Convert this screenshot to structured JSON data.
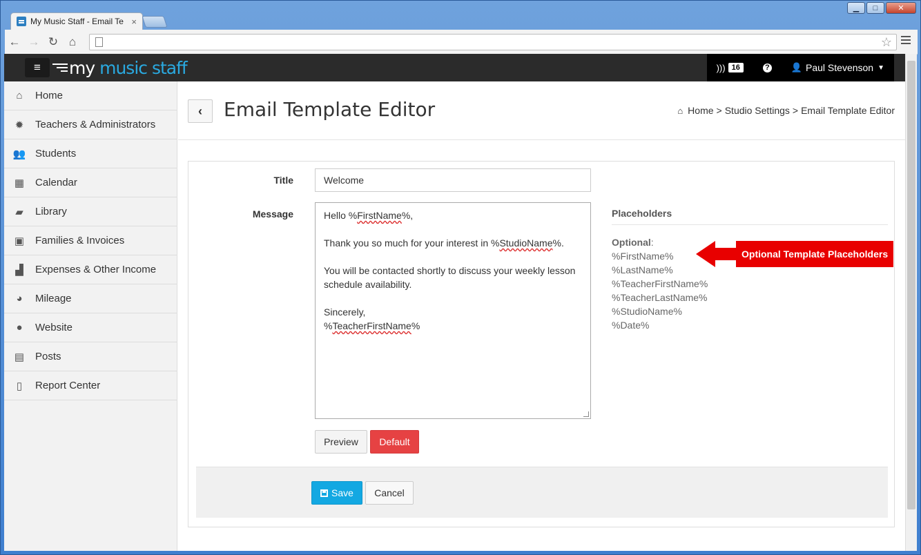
{
  "browser": {
    "tab_title": "My Music Staff - Email Te",
    "tab_close": "×",
    "url": ""
  },
  "header": {
    "logo_my": "my",
    "logo_rest": "music staff",
    "notifications_count": "16",
    "user_name": "Paul Stevenson"
  },
  "sidebar": {
    "items": [
      {
        "label": "Home",
        "icon": "home-icon"
      },
      {
        "label": "Teachers & Administrators",
        "icon": "gear-badge-icon"
      },
      {
        "label": "Students",
        "icon": "users-icon"
      },
      {
        "label": "Calendar",
        "icon": "calendar-icon"
      },
      {
        "label": "Library",
        "icon": "book-icon"
      },
      {
        "label": "Families & Invoices",
        "icon": "money-icon"
      },
      {
        "label": "Expenses & Other Income",
        "icon": "bar-chart-icon"
      },
      {
        "label": "Mileage",
        "icon": "dashboard-icon"
      },
      {
        "label": "Website",
        "icon": "globe-icon"
      },
      {
        "label": "Posts",
        "icon": "newspaper-icon"
      },
      {
        "label": "Report Center",
        "icon": "file-icon"
      }
    ]
  },
  "page": {
    "title": "Email Template Editor",
    "breadcrumb": [
      "Home",
      "Studio Settings",
      "Email Template Editor"
    ],
    "breadcrumb_sep": ">"
  },
  "form": {
    "title_label": "Title",
    "title_value": "Welcome",
    "message_label": "Message",
    "message_lines": {
      "greet_pre": "Hello %",
      "greet_var": "FirstName",
      "greet_post": "%,",
      "thanks_pre": "Thank you so much for your interest in %",
      "thanks_var": "StudioName",
      "thanks_post": "%.",
      "contact": "You will be contacted shortly to discuss your weekly lesson schedule availability.",
      "sincerely": "Sincerely,",
      "sign_pre": "%",
      "sign_var": "TeacherFirstName",
      "sign_post": "%"
    },
    "preview_label": "Preview",
    "default_label": "Default",
    "save_label": "Save",
    "cancel_label": "Cancel"
  },
  "placeholders": {
    "heading": "Placeholders",
    "optional_label": "Optional",
    "items": [
      "%FirstName%",
      "%LastName%",
      "%TeacherFirstName%",
      "%TeacherLastName%",
      "%StudioName%",
      "%Date%"
    ]
  },
  "callout": {
    "text": "Optional Template Placeholders"
  },
  "colors": {
    "header_bg": "#2b2b2b",
    "brand_blue": "#2aa9e0",
    "danger": "#e64243",
    "primary": "#13a8e2",
    "callout_red": "#e80000"
  }
}
